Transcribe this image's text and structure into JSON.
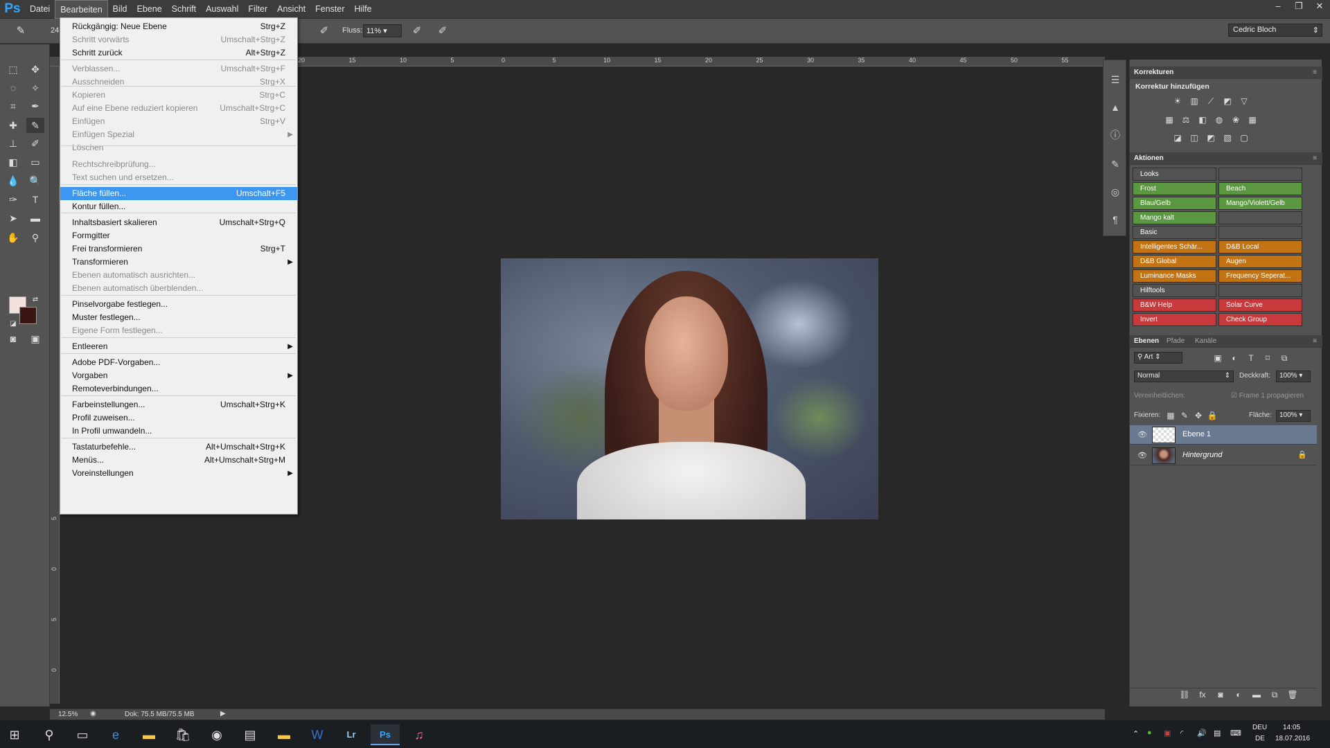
{
  "app": {
    "logo": "Ps",
    "accent": "#31a8ff"
  },
  "menubar": {
    "items": [
      "Datei",
      "Bearbeiten",
      "Bild",
      "Ebene",
      "Schrift",
      "Auswahl",
      "Filter",
      "Ansicht",
      "Fenster",
      "Hilfe"
    ],
    "active_index": 1
  },
  "window_controls": {
    "minimize": "–",
    "restore": "❐",
    "close": "✕"
  },
  "options": {
    "flow_label": "Fluss:",
    "flow_value": "11%",
    "brush_size": "24"
  },
  "workspace": {
    "value": "Cedric Bloch"
  },
  "edit_menu": {
    "items": [
      {
        "label": "Rückgängig: Neue Ebene",
        "shortcut": "Strg+Z",
        "disabled": false
      },
      {
        "label": "Schritt vorwärts",
        "shortcut": "Umschalt+Strg+Z",
        "disabled": true
      },
      {
        "label": "Schritt zurück",
        "shortcut": "Alt+Strg+Z",
        "disabled": false
      },
      {
        "label": "Verblassen...",
        "shortcut": "Umschalt+Strg+F",
        "disabled": true
      },
      {
        "label": "Ausschneiden",
        "shortcut": "Strg+X",
        "disabled": true
      },
      {
        "label": "Kopieren",
        "shortcut": "Strg+C",
        "disabled": true
      },
      {
        "label": "Auf eine Ebene reduziert kopieren",
        "shortcut": "Umschalt+Strg+C",
        "disabled": true
      },
      {
        "label": "Einfügen",
        "shortcut": "Strg+V",
        "disabled": true
      },
      {
        "label": "Einfügen Spezial",
        "shortcut": "",
        "disabled": true,
        "submenu": true
      },
      {
        "label": "Löschen",
        "shortcut": "",
        "disabled": true
      },
      {
        "label": "Rechtschreibprüfung...",
        "shortcut": "",
        "disabled": true
      },
      {
        "label": "Text suchen und ersetzen...",
        "shortcut": "",
        "disabled": true
      },
      {
        "label": "Fläche füllen...",
        "shortcut": "Umschalt+F5",
        "disabled": false,
        "highlighted": true
      },
      {
        "label": "Kontur füllen...",
        "shortcut": "",
        "disabled": false
      },
      {
        "label": "Inhaltsbasiert skalieren",
        "shortcut": "Umschalt+Strg+Q",
        "disabled": false
      },
      {
        "label": "Formgitter",
        "shortcut": "",
        "disabled": false
      },
      {
        "label": "Frei transformieren",
        "shortcut": "Strg+T",
        "disabled": false
      },
      {
        "label": "Transformieren",
        "shortcut": "",
        "disabled": false,
        "submenu": true
      },
      {
        "label": "Ebenen automatisch ausrichten...",
        "shortcut": "",
        "disabled": true
      },
      {
        "label": "Ebenen automatisch überblenden...",
        "shortcut": "",
        "disabled": true
      },
      {
        "label": "Pinselvorgabe festlegen...",
        "shortcut": "",
        "disabled": false
      },
      {
        "label": "Muster festlegen...",
        "shortcut": "",
        "disabled": false
      },
      {
        "label": "Eigene Form festlegen...",
        "shortcut": "",
        "disabled": true
      },
      {
        "label": "Entleeren",
        "shortcut": "",
        "disabled": false,
        "submenu": true
      },
      {
        "label": "Adobe PDF-Vorgaben...",
        "shortcut": "",
        "disabled": false
      },
      {
        "label": "Vorgaben",
        "shortcut": "",
        "disabled": false,
        "submenu": true
      },
      {
        "label": "Remoteverbindungen...",
        "shortcut": "",
        "disabled": false
      },
      {
        "label": "Farbeinstellungen...",
        "shortcut": "Umschalt+Strg+K",
        "disabled": false
      },
      {
        "label": "Profil zuweisen...",
        "shortcut": "",
        "disabled": false
      },
      {
        "label": "In Profil umwandeln...",
        "shortcut": "",
        "disabled": false
      },
      {
        "label": "Tastaturbefehle...",
        "shortcut": "Alt+Umschalt+Strg+K",
        "disabled": false
      },
      {
        "label": "Menüs...",
        "shortcut": "Alt+Umschalt+Strg+M",
        "disabled": false
      },
      {
        "label": "Voreinstellungen",
        "shortcut": "",
        "disabled": false,
        "submenu": true
      }
    ]
  },
  "ruler": {
    "h_ticks": [
      "20",
      "15",
      "10",
      "5",
      "0",
      "5",
      "10",
      "15",
      "20",
      "25",
      "30",
      "35",
      "40",
      "45",
      "50",
      "55"
    ],
    "v_ticks": [
      "5",
      "0",
      "5",
      "0",
      "5",
      "0",
      "5",
      "0",
      "5"
    ]
  },
  "statusbar": {
    "zoom": "12.5%",
    "doc": "Dok: 75.5 MB/75.5 MB"
  },
  "adjustments": {
    "tab": "Korrekturen",
    "subtitle": "Korrektur hinzufügen"
  },
  "actions": {
    "tab": "Aktionen",
    "cells": [
      {
        "label": "Looks",
        "color": "#535353"
      },
      {
        "label": "",
        "color": "#535353"
      },
      {
        "label": "Frost",
        "color": "#5b9740"
      },
      {
        "label": "Beach",
        "color": "#5b9740"
      },
      {
        "label": "Blau/Gelb",
        "color": "#5b9740"
      },
      {
        "label": "Mango/Violett/Gelb",
        "color": "#5b9740"
      },
      {
        "label": "Mango kalt",
        "color": "#5b9740"
      },
      {
        "label": "",
        "color": "#535353"
      },
      {
        "label": "Basic",
        "color": "#535353"
      },
      {
        "label": "",
        "color": "#535353"
      },
      {
        "label": "Intelligentes Schär...",
        "color": "#c27313"
      },
      {
        "label": "D&B Local",
        "color": "#c27313"
      },
      {
        "label": "D&B Global",
        "color": "#c27313"
      },
      {
        "label": "Augen",
        "color": "#c27313"
      },
      {
        "label": "Luminance Masks",
        "color": "#c27313"
      },
      {
        "label": "Frequency Seperat...",
        "color": "#c27313"
      },
      {
        "label": "Hilftools",
        "color": "#535353"
      },
      {
        "label": "",
        "color": "#535353"
      },
      {
        "label": "B&W Help",
        "color": "#c8393b"
      },
      {
        "label": "Solar Curve",
        "color": "#c8393b"
      },
      {
        "label": "Invert",
        "color": "#c8393b"
      },
      {
        "label": "Check Group",
        "color": "#c8393b"
      }
    ]
  },
  "layers": {
    "tabs": [
      "Ebenen",
      "Pfade",
      "Kanäle"
    ],
    "filter": "Art",
    "blend_mode": "Normal",
    "opacity_label": "Deckkraft:",
    "opacity": "100%",
    "unify_label": "Vereinheitlichen:",
    "propagate_label": "Frame 1 propagieren",
    "lock_label": "Fixieren:",
    "fill_label": "Fläche:",
    "fill": "100%",
    "items": [
      {
        "name": "Ebene 1",
        "selected": true
      },
      {
        "name": "Hintergrund",
        "selected": false
      }
    ]
  },
  "taskbar": {
    "time": "14:05",
    "date": "18.07.2016",
    "lang1": "DEU",
    "lang2": "DE"
  }
}
